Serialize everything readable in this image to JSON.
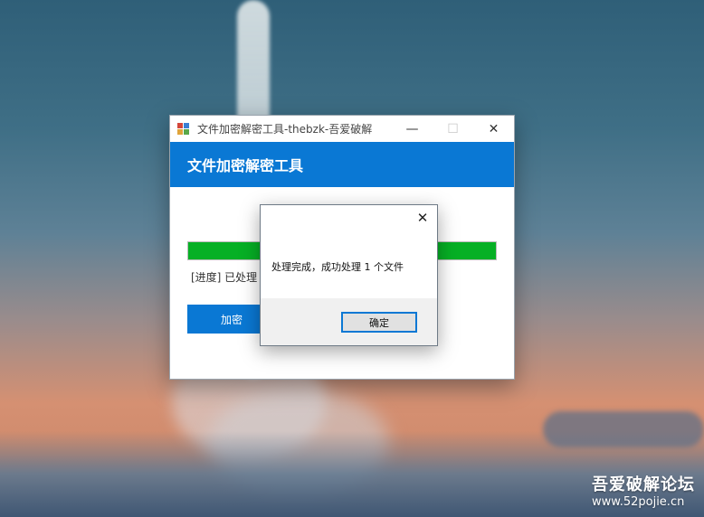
{
  "main_window": {
    "title": "文件加密解密工具-thebzk-吾爱破解",
    "controls": {
      "minimize": "—",
      "maximize": "☐",
      "close": "✕"
    },
    "header_title": "文件加密解密工具",
    "progress_value": 1.0,
    "status_text": "[进度] 已处理",
    "encrypt_button": "加密"
  },
  "dialog": {
    "close_glyph": "✕",
    "message": "处理完成，成功处理 1 个文件",
    "ok_button": "确定"
  },
  "watermark": {
    "main": "吾爱破解论坛",
    "url": "www.52pojie.cn"
  },
  "colors": {
    "accent": "#0a78d4",
    "progress": "#06b025"
  }
}
